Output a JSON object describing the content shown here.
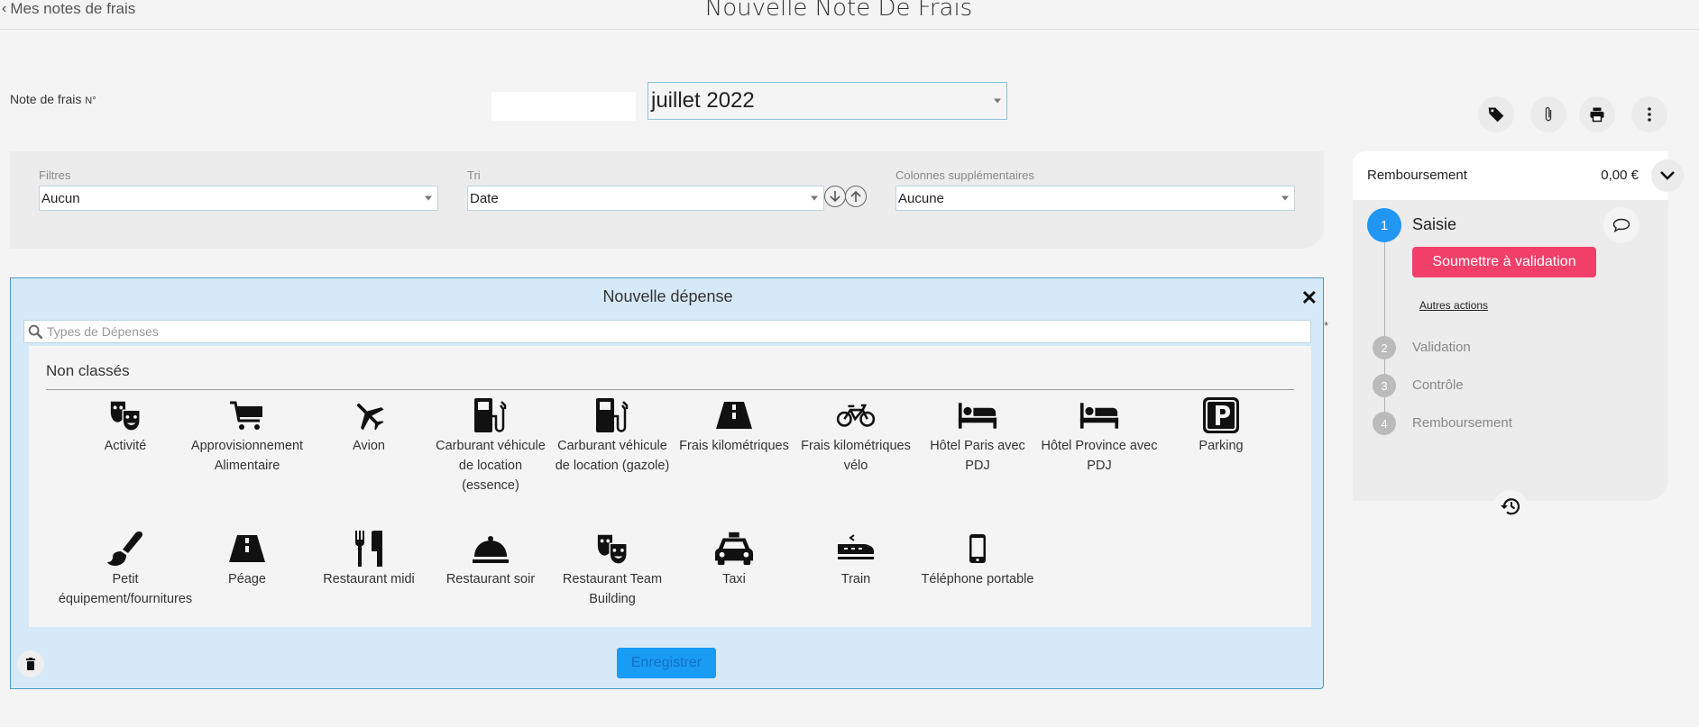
{
  "header": {
    "back_label": "Mes notes de frais",
    "title": "Nouvelle Note De Frais"
  },
  "note": {
    "number_label": "Note de frais",
    "number_suffix": "N°",
    "number_value": "",
    "period_value": "juillet 2022"
  },
  "toolbar": {
    "icons": [
      "tag-icon",
      "paperclip-icon",
      "print-icon",
      "more-vertical-icon"
    ]
  },
  "filters": {
    "filter_label": "Filtres",
    "filter_value": "Aucun",
    "sort_label": "Tri",
    "sort_value": "Date",
    "columns_label": "Colonnes supplémentaires",
    "columns_value": "Aucune"
  },
  "modal": {
    "title": "Nouvelle dépense",
    "required_marker": "*",
    "search_placeholder": "Types de Dépenses",
    "group_title": "Non classés",
    "types": [
      {
        "label": "Activité",
        "icon": "theater-masks-icon"
      },
      {
        "label": "Approvisionnement Alimentaire",
        "icon": "shopping-cart-icon"
      },
      {
        "label": "Avion",
        "icon": "airplane-icon"
      },
      {
        "label": "Carburant véhicule de location (essence)",
        "icon": "fuel-pump-icon"
      },
      {
        "label": "Carburant véhicule de location (gazole)",
        "icon": "fuel-pump-icon"
      },
      {
        "label": "Frais kilométriques",
        "icon": "road-icon"
      },
      {
        "label": "Frais kilométriques vélo",
        "icon": "bicycle-icon"
      },
      {
        "label": "Hôtel Paris avec PDJ",
        "icon": "bed-icon"
      },
      {
        "label": "Hôtel Province avec PDJ",
        "icon": "bed-icon"
      },
      {
        "label": "Parking",
        "icon": "parking-icon"
      },
      {
        "label": "Petit équipement/fournitures",
        "icon": "paint-brush-icon"
      },
      {
        "label": "Péage",
        "icon": "road-icon"
      },
      {
        "label": "Restaurant midi",
        "icon": "fork-knife-icon"
      },
      {
        "label": "Restaurant soir",
        "icon": "cloche-icon"
      },
      {
        "label": "Restaurant Team Building",
        "icon": "theater-masks-icon"
      },
      {
        "label": "Taxi",
        "icon": "taxi-icon"
      },
      {
        "label": "Train",
        "icon": "train-icon"
      },
      {
        "label": "Téléphone portable",
        "icon": "mobile-phone-icon"
      }
    ],
    "save_label": "Enregistrer"
  },
  "workflow": {
    "title": "Remboursement",
    "amount": "0,00 €",
    "steps": [
      {
        "num": "1",
        "label": "Saisie",
        "active": true
      },
      {
        "num": "2",
        "label": "Validation",
        "active": false
      },
      {
        "num": "3",
        "label": "Contrôle",
        "active": false
      },
      {
        "num": "4",
        "label": "Remboursement",
        "active": false
      }
    ],
    "submit_label": "Soumettre à validation",
    "other_actions_label": "Autres actions"
  },
  "colors": {
    "accent_blue": "#2196f3",
    "submit_pink": "#f23f6a",
    "save_blue": "#1a9bf4",
    "modal_bg": "#d6e9f8"
  }
}
